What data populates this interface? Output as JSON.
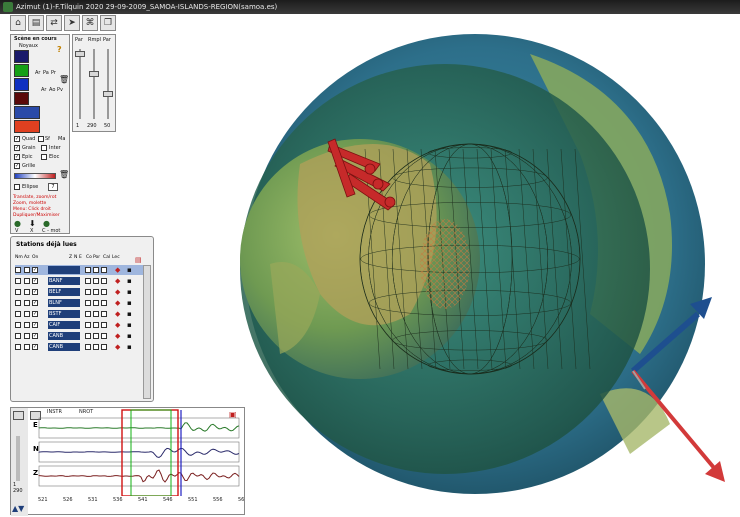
{
  "window": {
    "title": "Azimut (1)-F.Tilquin 2020 29-09-2009_SAMOA-ISLANDS-REGION(samoa.es)"
  },
  "toolbar": {
    "icons": [
      "home-icon",
      "document-icon",
      "swap-icon",
      "arrow-icon",
      "network-icon",
      "stack-icon"
    ]
  },
  "scene": {
    "title": "Scène en cours",
    "subtitle": "Noyaux",
    "help": "?",
    "layer_labels": [
      "Ar",
      "Pa",
      "Pr",
      "Ar",
      "Ao",
      "Pv"
    ],
    "options": [
      {
        "label": "Quad",
        "checked": true
      },
      {
        "label": "Sf",
        "checked": false
      },
      {
        "label": "Ma",
        "checked": false
      },
      {
        "label": "Grain",
        "checked": true
      },
      {
        "label": "Inter",
        "checked": false
      },
      {
        "label": "Epic",
        "checked": true
      },
      {
        "label": "Eloc",
        "checked": false
      },
      {
        "label": "Grille",
        "checked": true
      },
      {
        "label": "Ellipse",
        "checked": false
      }
    ],
    "ellipse_value": "7",
    "hints": [
      "Translate, zoom/rot",
      "Zoom, molette",
      "Menu: Click droit",
      "Dupliquer/Maximiser"
    ],
    "bottom_labels": [
      "V",
      "X",
      "C - mot"
    ]
  },
  "sliders": {
    "headers": [
      "Par",
      "Rmpl",
      "Par"
    ],
    "values": [
      "1",
      "290",
      "50"
    ]
  },
  "stations": {
    "title": "Stations déjà lues",
    "headers": [
      "Nm",
      "Az",
      "On",
      "Z",
      "N",
      "E",
      "Co",
      "Por",
      "Cal",
      "Lec"
    ],
    "rows": [
      {
        "name": "",
        "selected": true
      },
      {
        "name": "BANF",
        "selected": false
      },
      {
        "name": "BELF",
        "selected": false
      },
      {
        "name": "BLNF",
        "selected": false
      },
      {
        "name": "BSTF",
        "selected": false
      },
      {
        "name": "CAIF",
        "selected": false
      },
      {
        "name": "CANB",
        "selected": false
      },
      {
        "name": "CANB",
        "selected": false
      }
    ]
  },
  "seismogram": {
    "header": [
      "INSTR",
      "NROT"
    ],
    "traces": [
      "E",
      "N",
      "Z"
    ],
    "side_value": "1",
    "side_value2": "290",
    "axis_ticks": [
      "521",
      "526",
      "531",
      "536",
      "541",
      "546",
      "551",
      "556",
      "56"
    ],
    "colors": {
      "E": "#2a7a2a",
      "N": "#2a2a6a",
      "Z": "#7a1f1f",
      "window_red": "#d01010",
      "window_green": "#10b010",
      "window_blue": "#2020c0"
    }
  },
  "globe": {
    "colors": {
      "ocean": "#2d6f8a",
      "land": "#7a9a4a",
      "shell": "#2f6f5a",
      "arrow_blue": "#1e4f8f",
      "arrow_red": "#d23a3a"
    }
  }
}
